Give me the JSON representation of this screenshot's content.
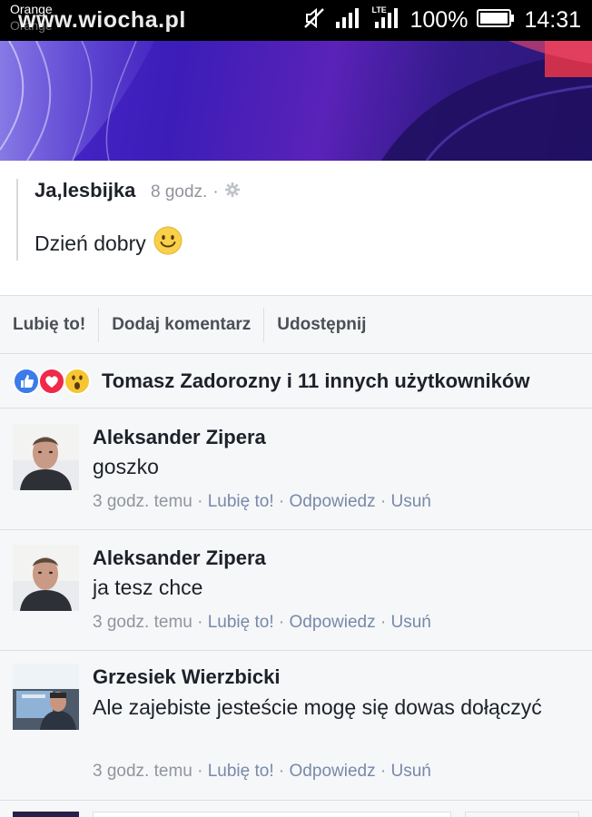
{
  "status_bar": {
    "carrier": "Orange",
    "carrier_ghost": "Orange",
    "watermark": "www.wiocha.pl",
    "network_label": "LTE",
    "battery_percent": "100%",
    "time": "14:31",
    "icons": [
      "mute-icon",
      "signal-icon",
      "lte-signal-icon",
      "battery-icon"
    ]
  },
  "post": {
    "author": "Ja,lesbijka",
    "time": "8 godz.",
    "separator": "·",
    "privacy_icon": "gear-icon",
    "text": "Dzień dobry",
    "emoji": "smile-emoji-icon"
  },
  "actions": {
    "like": "Lubię to!",
    "comment": "Dodaj komentarz",
    "share": "Udostępnij"
  },
  "reactions": {
    "icons": [
      "like-reaction-icon",
      "love-reaction-icon",
      "wow-reaction-icon"
    ],
    "summary": "Tomasz Zadorozny i 11 innych użytkowników"
  },
  "comments": [
    {
      "author": "Aleksander Zipera",
      "text": "goszko",
      "time": "3 godz. temu",
      "sep": " · ",
      "like": "Lubię to!",
      "reply": "Odpowiedz",
      "delete": "Usuń"
    },
    {
      "author": "Aleksander Zipera",
      "text": "ja tesz chce",
      "time": "3 godz. temu",
      "sep": " · ",
      "like": "Lubię to!",
      "reply": "Odpowiedz",
      "delete": "Usuń"
    },
    {
      "author": "Grzesiek Wierzbicki",
      "text": "Ale zajebiste jesteście mogę się dowas dołączyć",
      "time": "3 godz. temu",
      "sep": " · ",
      "like": "Lubię to!",
      "reply": "Odpowiedz",
      "delete": "Usuń"
    }
  ],
  "colors": {
    "link_muted": "#7889a8",
    "meta_gray": "#90949c",
    "cover_purple": "#4a2bd0",
    "like_blue": "#3b7bea",
    "love_red": "#f0284a",
    "wow_yellow": "#f7c531"
  }
}
